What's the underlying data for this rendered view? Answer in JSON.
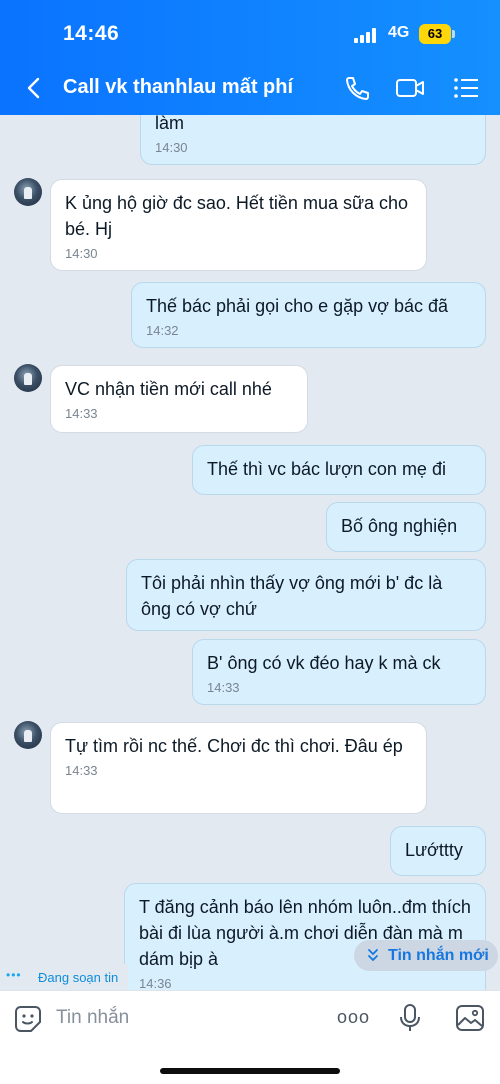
{
  "status_bar": {
    "time": "14:46",
    "network": "4G",
    "battery": "63"
  },
  "header": {
    "title": "Call vk thanhlau mất phí",
    "icons": [
      "back-icon",
      "phone-icon",
      "video-call-icon",
      "menu-list-icon"
    ]
  },
  "messages": [
    {
      "side": "out",
      "text": "làm",
      "time": "14:30"
    },
    {
      "side": "in",
      "text": "K ủng hộ giờ đc sao. Hết tiền mua sữa cho bé. Hj",
      "time": "14:30"
    },
    {
      "side": "out",
      "text": "Thế bác phải gọi cho e gặp vợ bác đã",
      "time": "14:32"
    },
    {
      "side": "in",
      "text": "VC nhận tiền mới call nhé",
      "time": "14:33"
    },
    {
      "side": "out",
      "text": "Thế thì vc bác lượn con mẹ đi",
      "time": ""
    },
    {
      "side": "out",
      "text": "Bố ông nghiện",
      "time": ""
    },
    {
      "side": "out",
      "text": "Tôi phải nhìn thấy vợ ông mới b' đc là ông có vợ chứ",
      "time": ""
    },
    {
      "side": "out",
      "text": "B' ông có vk đéo hay k mà ck",
      "time": "14:33"
    },
    {
      "side": "in",
      "text": "Tự tìm rồi nc thế. Chơi đc thì chơi. Đâu ép",
      "time": "14:33"
    },
    {
      "side": "out",
      "text": "Lướttty",
      "time": ""
    },
    {
      "side": "out",
      "text": "T đăng cảnh báo lên nhóm luôn..đm thích bài đi lùa người à.m chơi diễn đàn mà m dám bịp à",
      "time": "14:36"
    }
  ],
  "typing": {
    "dots": "•••",
    "label": "Đang soạn tin"
  },
  "new_message_button": {
    "label": "Tin nhắn mới",
    "icon": "double-chevron-down-icon"
  },
  "composer": {
    "placeholder": "Tin nhắn",
    "more_label": "ooo",
    "icons": [
      "sticker-icon",
      "more-icon",
      "microphone-icon",
      "image-icon"
    ]
  },
  "colors": {
    "header_start": "#0a73ff",
    "header_end": "#1590ff",
    "outgoing_bubble": "#d8f0fe",
    "incoming_bubble": "#ffffff",
    "background": "#e2e9f1",
    "accent": "#1677e0"
  }
}
